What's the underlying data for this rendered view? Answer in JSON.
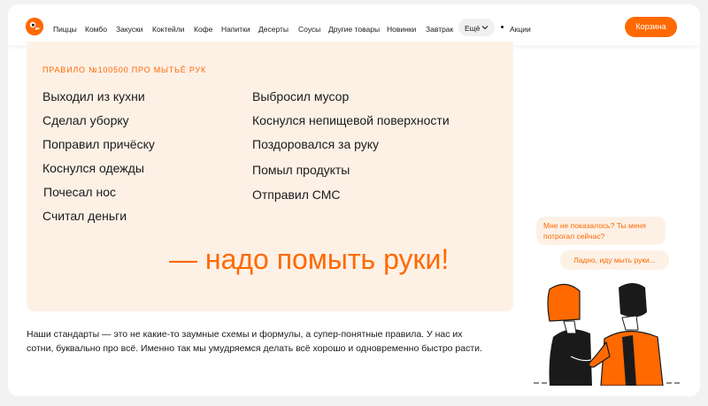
{
  "nav": {
    "items": [
      "Пиццы",
      "Комбо",
      "Закуски",
      "Коктейли",
      "Кофе",
      "Напитки",
      "Десерты",
      "Соусы",
      "Другие товары",
      "Новинки",
      "Завтрак"
    ],
    "more_label": "Ещё",
    "promo_label": "Акции",
    "cart_label": "Корзина"
  },
  "rule": {
    "title": "ПРАВИЛО №100500 ПРО МЫТЬЁ РУК",
    "left_items": [
      "Выходил из кухни",
      "Сделал уборку",
      "Поправил причёску",
      "Коснулся одежды",
      "Почесал нос",
      "Считал деньги"
    ],
    "right_items": [
      "Выбросил мусор",
      "Коснулся непищевой поверхности",
      "Поздоровался за руку",
      "Помыл продукты",
      "Отправил СМС"
    ],
    "slogan": "— надо помыть руки!"
  },
  "dialog": {
    "bubble1": "Мне не показалось? Ты меня потрогал сейчас?",
    "bubble2": "Ладно, иду мыть руки..."
  },
  "standards_text": "Наши стандарты — это не какие-то заумные схемы и формулы, а супер-понятные правила. У нас их сотни, буквально про всё. Именно так мы умудряемся делать всё хорошо и одновременно быстро расти.",
  "colors": {
    "accent": "#ff6900",
    "card_bg": "#fdf1e6",
    "text": "#1a1a1a"
  },
  "icons": {
    "logo": "dodo-logo-icon",
    "more": "chevron-down-icon"
  }
}
